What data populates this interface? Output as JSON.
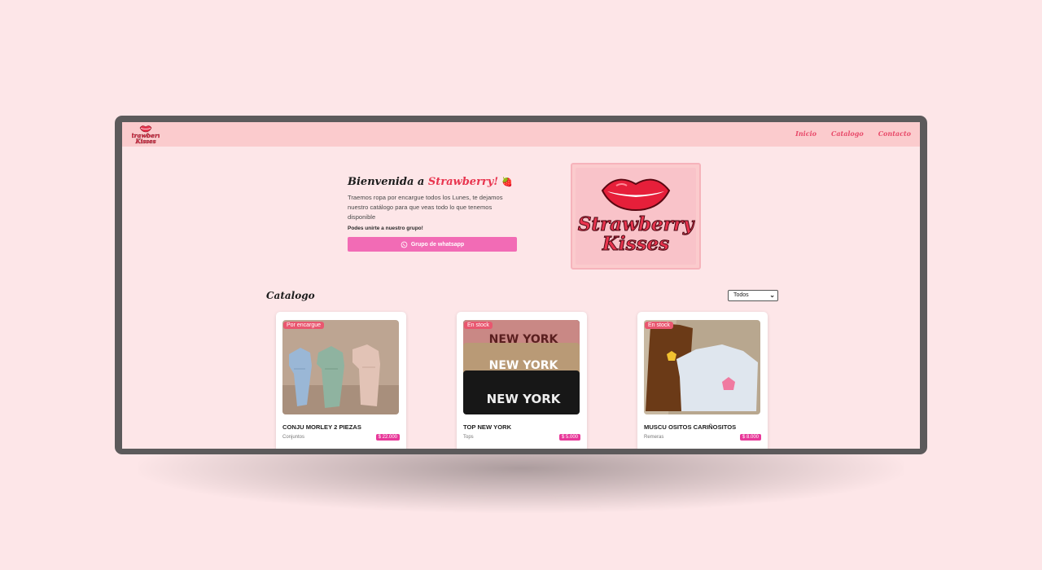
{
  "brand": {
    "logo_text_1": "Strawberry",
    "logo_text_2": "Kisses"
  },
  "nav": {
    "links": [
      "Inicio",
      "Catalogo",
      "Contacto"
    ]
  },
  "hero": {
    "title_prefix": "Bienvenida a ",
    "title_accent": "Strawberry!",
    "title_emoji": "🍓",
    "description": "Traemos ropa por encargue todos los Lunes, te dejamos nuestro catálogo para que veas todo lo que tenemos disponible",
    "join_text": "Podes unirte a nuestro grupo!",
    "whatsapp_button": "Grupo de whatsapp"
  },
  "catalog": {
    "title": "Catalogo",
    "filter_value": "Todos",
    "products": [
      {
        "badge": "Por encargue",
        "name": "CONJU MORLEY 2 PIEZAS",
        "category": "Conjuntos",
        "price": "$ 22.000"
      },
      {
        "badge": "En stock",
        "name": "TOP NEW YORK",
        "category": "Tops",
        "price": "$ 5.000",
        "image_text": "NEW YORK"
      },
      {
        "badge": "En stock",
        "name": "MUSCU OSITOS CARIÑOSITOS",
        "category": "Remeras",
        "price": "$ 8.000"
      }
    ]
  },
  "colors": {
    "background": "#fde6e8",
    "navbar": "#fbcbcd",
    "accent": "#e8344e",
    "button": "#f26bb5",
    "price_badge": "#e8399a",
    "stock_badge": "#e9576f"
  }
}
